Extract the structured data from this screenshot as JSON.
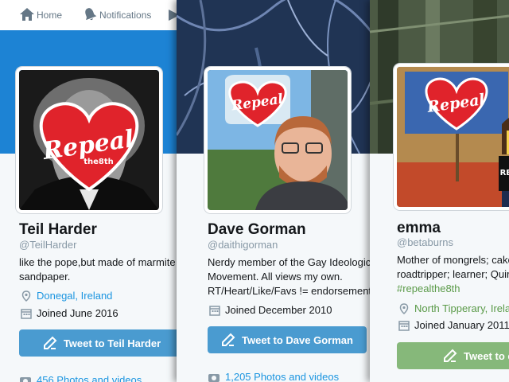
{
  "nav": {
    "home": "Home",
    "notifications": "Notifications"
  },
  "colors": {
    "twitter_blue": "#1da1f2",
    "button_blue": "#4a9bd0",
    "button_green": "#86b87a",
    "link_blue": "#1b95e0",
    "repeal_red": "#e0232b"
  },
  "repeal_logo": {
    "main": "Repeal",
    "sub": "the8th"
  },
  "profiles": [
    {
      "name": "Teil Harder",
      "handle": "@TeilHarder",
      "bio": [
        "like the pope,but made of marmite a",
        "sandpaper."
      ],
      "location": "Donegal, Ireland",
      "joined": "Joined June 2016",
      "button": "Tweet to Teil Harder",
      "photos": "456 Photos and videos"
    },
    {
      "name": "Dave Gorman",
      "handle": "@daithigorman",
      "bio": [
        "Nerdy member of the Gay Ideological",
        "Movement. All views my own.",
        "RT/Heart/Like/Favs != endorsement"
      ],
      "joined": "Joined December 2010",
      "button": "Tweet to Dave Gorman",
      "photos": "1,205 Photos and videos"
    },
    {
      "name": "emma",
      "handle": "@betaburns",
      "bio": [
        "Mother of mongrels; cake",
        "roadtripper; learner; Quirk"
      ],
      "hashtag": "#repealthe8th",
      "location": "North Tipperary, Irela",
      "joined": "Joined January 2011",
      "button": "Tweet to e",
      "figure_shirt": "REPEAL"
    }
  ]
}
